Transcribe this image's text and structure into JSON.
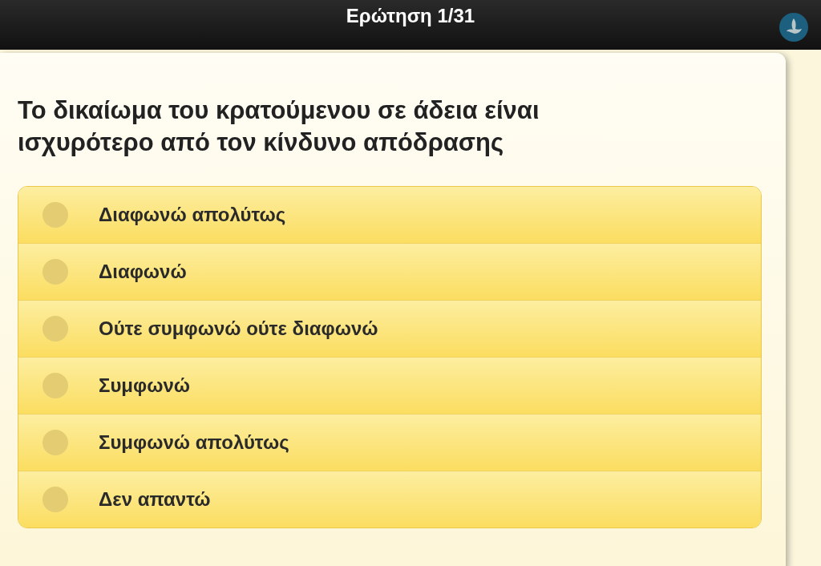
{
  "header": {
    "title": "Ερώτηση 1/31"
  },
  "question": "Το δικαίωμα του κρατούμενου σε άδεια είναι ισχυρότερο από τον κίνδυνο απόδρασης",
  "options": [
    {
      "label": "Διαφωνώ απολύτως",
      "selected": false
    },
    {
      "label": "Διαφωνώ",
      "selected": false
    },
    {
      "label": "Ούτε συμφωνώ ούτε διαφωνώ",
      "selected": false
    },
    {
      "label": "Συμφωνώ",
      "selected": false
    },
    {
      "label": "Συμφωνώ απολύτως",
      "selected": false
    },
    {
      "label": "Δεν απαντώ",
      "selected": false
    }
  ]
}
